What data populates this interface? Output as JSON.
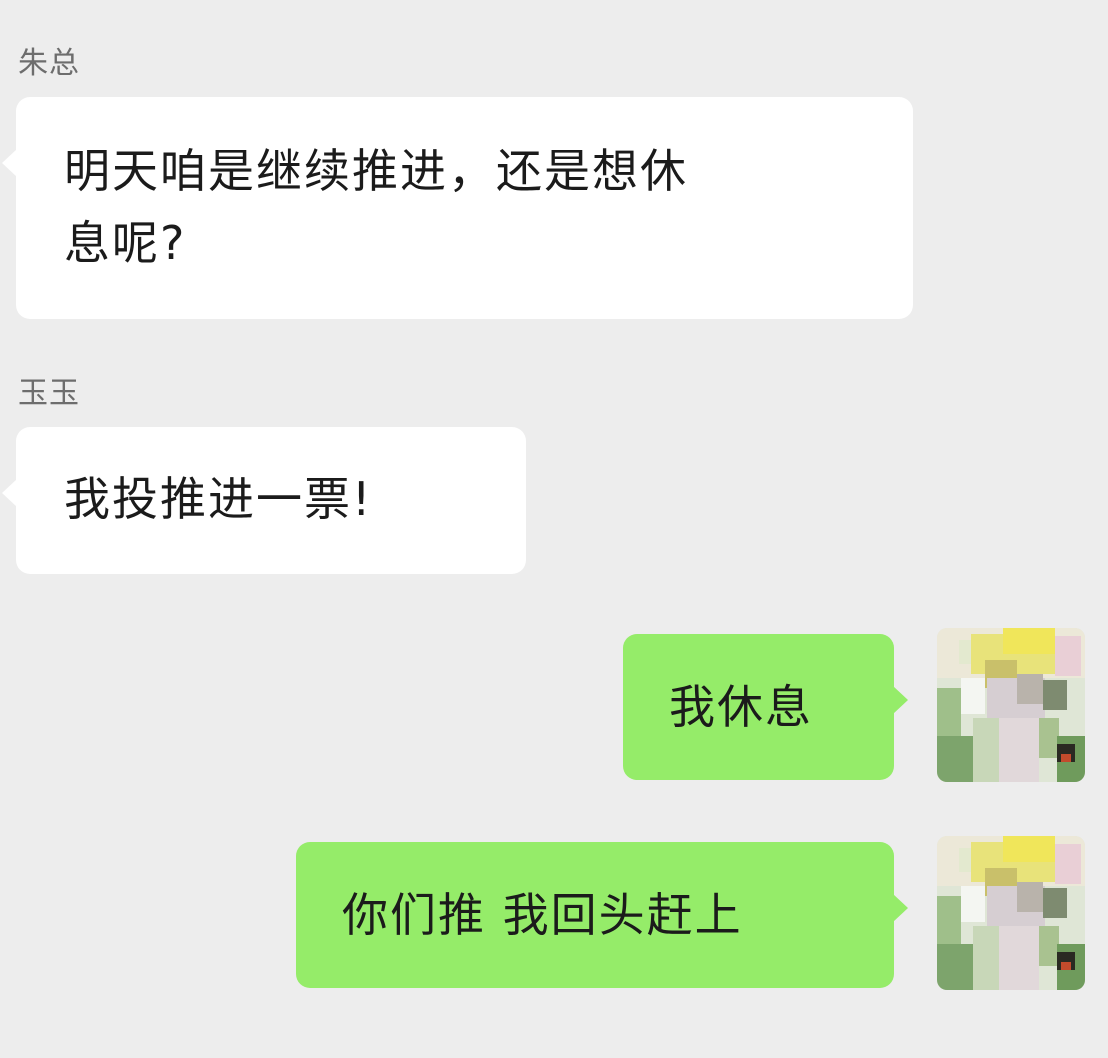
{
  "messages": [
    {
      "direction": "incoming",
      "sender": "朱总",
      "text": "明天咱是继续推进，还是想休\n息呢?"
    },
    {
      "direction": "incoming",
      "sender": "玉玉",
      "text": "我投推进一票!"
    },
    {
      "direction": "outgoing",
      "text": "我休息",
      "avatar": "self-avatar-pixelated"
    },
    {
      "direction": "outgoing",
      "text": "你们推 我回头赶上",
      "avatar": "self-avatar-pixelated"
    }
  ],
  "colors": {
    "background": "#ededed",
    "incoming_bubble": "#ffffff",
    "outgoing_bubble": "#95ec69",
    "sender_name": "#6d6d6d"
  }
}
